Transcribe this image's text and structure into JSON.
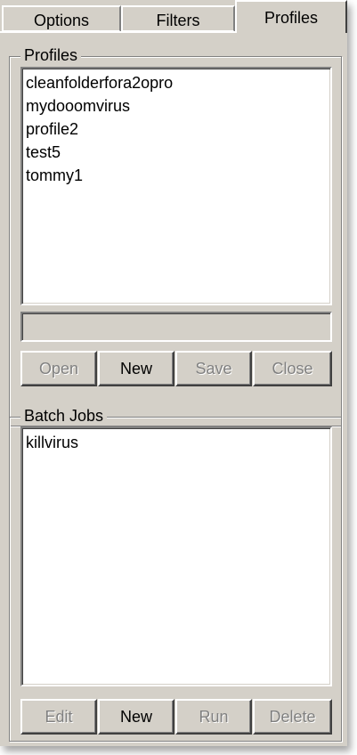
{
  "tabs": [
    {
      "label": "Options"
    },
    {
      "label": "Filters"
    },
    {
      "label": "Profiles"
    }
  ],
  "profiles_group": {
    "title": "Profiles",
    "items": [
      "cleanfolderfora2opro",
      "mydooomvirus",
      "profile2",
      "test5",
      "tommy1"
    ],
    "name_field_value": "",
    "buttons": {
      "open": "Open",
      "new": "New",
      "save": "Save",
      "close": "Close"
    }
  },
  "batch_group": {
    "title": "Batch Jobs",
    "items": [
      "killvirus"
    ],
    "buttons": {
      "edit": "Edit",
      "new": "New",
      "run": "Run",
      "delete": "Delete"
    }
  },
  "colors": {
    "face": "#d4d0c8",
    "highlight": "#ffffff",
    "shadow": "#808080",
    "disabled_text": "#808080"
  }
}
